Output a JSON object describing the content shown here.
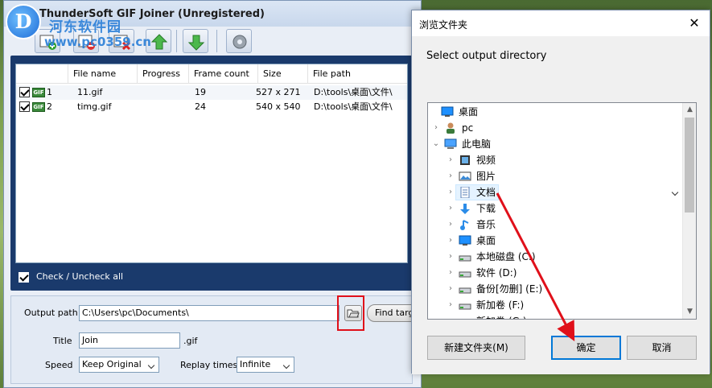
{
  "app": {
    "title": "ThunderSoft GIF Joiner (Unregistered)",
    "watermark_text": "河东软件园",
    "watermark_url": "www.pc0359.cn",
    "watermark_logo": "D",
    "columns": [
      "File name",
      "Progress",
      "Frame count",
      "Size",
      "File path"
    ],
    "rows": [
      {
        "index": "1",
        "name": "11.gif",
        "progress": "",
        "frames": "19",
        "size": "527 x 271",
        "path": "D:\\tools\\桌面\\文件\\"
      },
      {
        "index": "2",
        "name": "timg.gif",
        "progress": "",
        "frames": "24",
        "size": "540 x 540",
        "path": "D:\\tools\\桌面\\文件\\"
      }
    ],
    "gif_icon_label": "GIF",
    "check_all": "Check / Uncheck all",
    "output_path_label": "Output path",
    "output_path_value": "C:\\Users\\pc\\Documents\\",
    "find_target_label": "Find targe",
    "title_label": "Title",
    "title_value": "Join",
    "title_ext": ".gif",
    "speed_label": "Speed",
    "speed_value": "Keep Original",
    "replay_label": "Replay times",
    "replay_value": "Infinite",
    "toolbar_icons": [
      "add-file-icon",
      "remove-file-icon",
      "clear-list-icon",
      "move-up-icon",
      "move-down-icon",
      "settings-icon"
    ]
  },
  "dialog": {
    "title": "浏览文件夹",
    "close": "✕",
    "instruction": "Select output directory",
    "tree": [
      {
        "label": "桌面",
        "level": 0,
        "expand": "",
        "icon": "desktop-icon"
      },
      {
        "label": "pc",
        "level": 1,
        "expand": "›",
        "icon": "user-icon"
      },
      {
        "label": "此电脑",
        "level": 1,
        "expand": "⌄",
        "icon": "computer-icon"
      },
      {
        "label": "视频",
        "level": 2,
        "expand": "›",
        "icon": "video-folder-icon"
      },
      {
        "label": "图片",
        "level": 2,
        "expand": "›",
        "icon": "pictures-folder-icon"
      },
      {
        "label": "文档",
        "level": 2,
        "expand": "›",
        "icon": "documents-folder-icon",
        "selected": true
      },
      {
        "label": "下载",
        "level": 2,
        "expand": "›",
        "icon": "downloads-folder-icon"
      },
      {
        "label": "音乐",
        "level": 2,
        "expand": "›",
        "icon": "music-folder-icon"
      },
      {
        "label": "桌面",
        "level": 2,
        "expand": "›",
        "icon": "desktop-icon"
      },
      {
        "label": "本地磁盘 (C:)",
        "level": 2,
        "expand": "›",
        "icon": "drive-icon"
      },
      {
        "label": "软件 (D:)",
        "level": 2,
        "expand": "›",
        "icon": "drive-icon"
      },
      {
        "label": "备份[勿删] (E:)",
        "level": 2,
        "expand": "›",
        "icon": "drive-icon"
      },
      {
        "label": "新加卷 (F:)",
        "level": 2,
        "expand": "›",
        "icon": "drive-icon"
      },
      {
        "label": "新加卷 (G:)",
        "level": 2,
        "expand": "›",
        "icon": "drive-icon"
      }
    ],
    "new_folder": "新建文件夹(M)",
    "ok": "确定",
    "cancel": "取消"
  },
  "colors": {
    "annotation_red": "#e0101a",
    "dialog_focus_blue": "#0078d7",
    "list_panel_navy": "#1a3a6c"
  }
}
